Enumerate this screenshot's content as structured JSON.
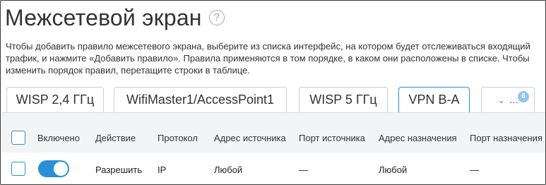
{
  "page": {
    "title": "Межсетевой экран",
    "help_icon": "question-circle-icon",
    "description": "Чтобы добавить правило межсетевого экрана, выберите из списка интерфейс, на котором будет отслеживаться входящий трафик, и нажмите «Добавить правило». Правила применяются в том порядке, в каком они расположены в списке. Чтобы изменить порядок правил, перетащите строки в таблице."
  },
  "tabs": [
    {
      "label": "WISP 2,4 ГГц",
      "active": false
    },
    {
      "label": "WifiMaster1/AccessPoint1",
      "active": false
    },
    {
      "label": "WISP 5 ГГц",
      "active": false
    },
    {
      "label": "VPN B-A",
      "active": true
    },
    {
      "label": "...",
      "icon": "chevron-down-icon",
      "badge": "6"
    }
  ],
  "table": {
    "columns": [
      "Включено",
      "Действие",
      "Протокол",
      "Адрес источника",
      "Порт источника",
      "Адрес назначения",
      "Порт назначения"
    ],
    "rows": [
      {
        "enabled": true,
        "action": "Разрешить",
        "protocol": "IP",
        "src_address": "Любой",
        "src_port": "—",
        "dst_address": "Любой",
        "dst_port": "—"
      }
    ]
  },
  "colors": {
    "accent": "#2b8fd6",
    "badge": "#8fc6e9",
    "header_bg": "#f3f4f5"
  }
}
